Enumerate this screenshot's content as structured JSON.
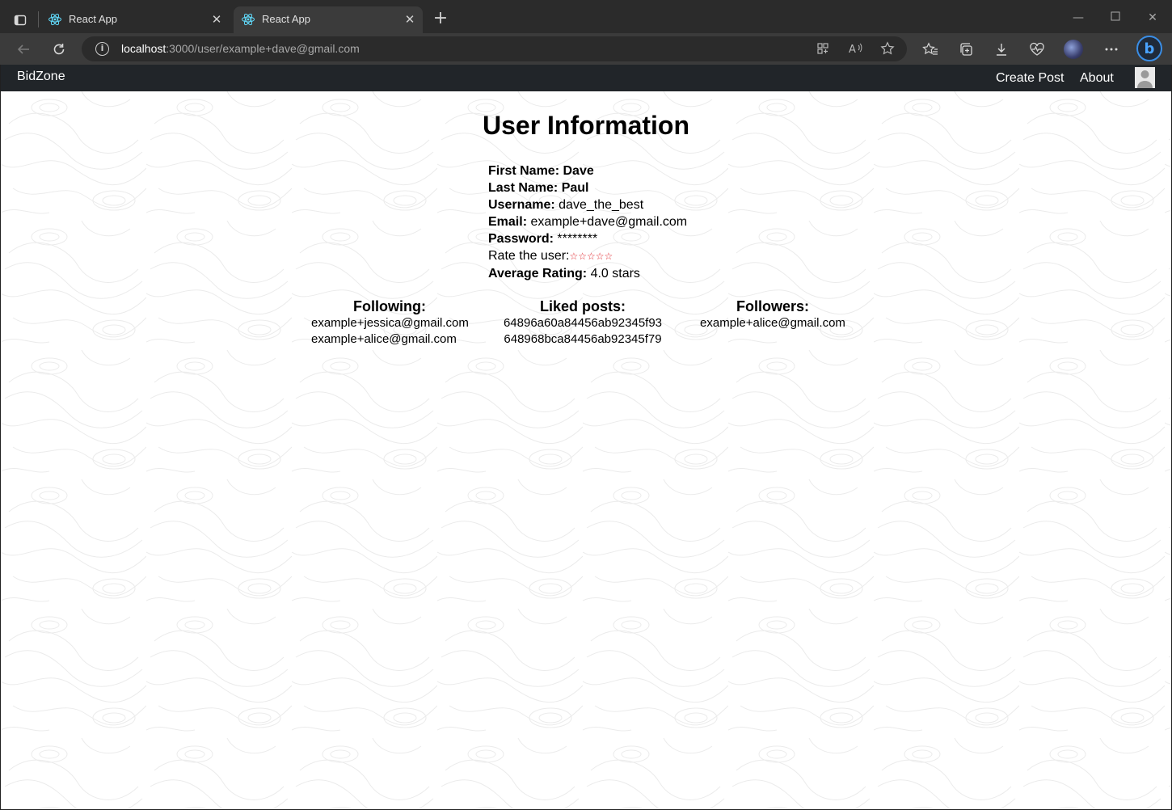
{
  "browser": {
    "tabs": [
      {
        "title": "React App",
        "active": false
      },
      {
        "title": "React App",
        "active": true
      }
    ],
    "url_host": "localhost",
    "url_rest": ":3000/user/example+dave@gmail.com"
  },
  "navbar": {
    "brand": "BidZone",
    "links": [
      "Create Post",
      "About"
    ]
  },
  "page": {
    "title": "User Information",
    "fields": {
      "first_name": {
        "label": "First Name:",
        "value": "Dave"
      },
      "last_name": {
        "label": "Last Name:",
        "value": "Paul"
      },
      "username": {
        "label": "Username:",
        "value": "dave_the_best"
      },
      "email": {
        "label": "Email:",
        "value": "example+dave@gmail.com"
      },
      "password": {
        "label": "Password:",
        "value": "********"
      },
      "rate": {
        "label": "Rate the user:",
        "stars": "☆☆☆☆☆"
      },
      "average": {
        "label": "Average Rating:",
        "value": "4.0 stars"
      }
    },
    "following": {
      "title": "Following:",
      "items": [
        "example+jessica@gmail.com",
        "example+alice@gmail.com"
      ]
    },
    "liked": {
      "title": "Liked posts:",
      "items": [
        "64896a60a84456ab92345f93",
        "648968bca84456ab92345f79"
      ]
    },
    "followers": {
      "title": "Followers:",
      "items": [
        "example+alice@gmail.com"
      ]
    }
  },
  "colors": {
    "navbar": "#212529",
    "stars": "#e0242b",
    "accent": "#3a8ee6"
  }
}
